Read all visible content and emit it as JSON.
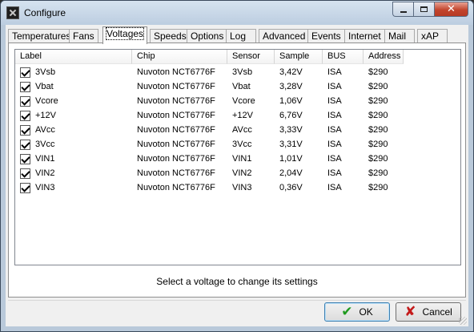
{
  "window": {
    "title": "Configure",
    "icon": "app-icon",
    "caption_buttons": {
      "minimize": "–",
      "maximize": "□",
      "close": "✕"
    }
  },
  "tabs": [
    {
      "label": "Temperatures"
    },
    {
      "label": "Fans"
    },
    {
      "label": "Voltages",
      "active": true
    },
    {
      "label": "Speeds"
    },
    {
      "label": "Options"
    },
    {
      "label": "Log"
    },
    {
      "label": "Advanced"
    },
    {
      "label": "Events"
    },
    {
      "label": "Internet"
    },
    {
      "label": "Mail"
    },
    {
      "label": "xAP"
    }
  ],
  "list": {
    "columns": [
      "Label",
      "Chip",
      "Sensor",
      "Sample",
      "BUS",
      "Address"
    ],
    "rows": [
      {
        "label": "3Vsb",
        "chip": "Nuvoton NCT6776F",
        "sensor": "3Vsb",
        "sample": "3,42V",
        "bus": "ISA",
        "address": "$290",
        "checked": true
      },
      {
        "label": "Vbat",
        "chip": "Nuvoton NCT6776F",
        "sensor": "Vbat",
        "sample": "3,28V",
        "bus": "ISA",
        "address": "$290",
        "checked": true
      },
      {
        "label": "Vcore",
        "chip": "Nuvoton NCT6776F",
        "sensor": "Vcore",
        "sample": "1,06V",
        "bus": "ISA",
        "address": "$290",
        "checked": true
      },
      {
        "label": "+12V",
        "chip": "Nuvoton NCT6776F",
        "sensor": "+12V",
        "sample": "6,76V",
        "bus": "ISA",
        "address": "$290",
        "checked": true
      },
      {
        "label": "AVcc",
        "chip": "Nuvoton NCT6776F",
        "sensor": "AVcc",
        "sample": "3,33V",
        "bus": "ISA",
        "address": "$290",
        "checked": true
      },
      {
        "label": "3Vcc",
        "chip": "Nuvoton NCT6776F",
        "sensor": "3Vcc",
        "sample": "3,31V",
        "bus": "ISA",
        "address": "$290",
        "checked": true
      },
      {
        "label": "VIN1",
        "chip": "Nuvoton NCT6776F",
        "sensor": "VIN1",
        "sample": "1,01V",
        "bus": "ISA",
        "address": "$290",
        "checked": true
      },
      {
        "label": "VIN2",
        "chip": "Nuvoton NCT6776F",
        "sensor": "VIN2",
        "sample": "2,04V",
        "bus": "ISA",
        "address": "$290",
        "checked": true
      },
      {
        "label": "VIN3",
        "chip": "Nuvoton NCT6776F",
        "sensor": "VIN3",
        "sample": "0,36V",
        "bus": "ISA",
        "address": "$290",
        "checked": true
      }
    ]
  },
  "hint": "Select a voltage to change its settings",
  "buttons": {
    "ok": "OK",
    "cancel": "Cancel"
  },
  "icons": {
    "ok": "checkmark-icon",
    "cancel": "x-mark-icon"
  },
  "colors": {
    "ok_icon": "#1f9a1f",
    "cancel_icon": "#c41a1a",
    "close_button": "#c2452d"
  }
}
